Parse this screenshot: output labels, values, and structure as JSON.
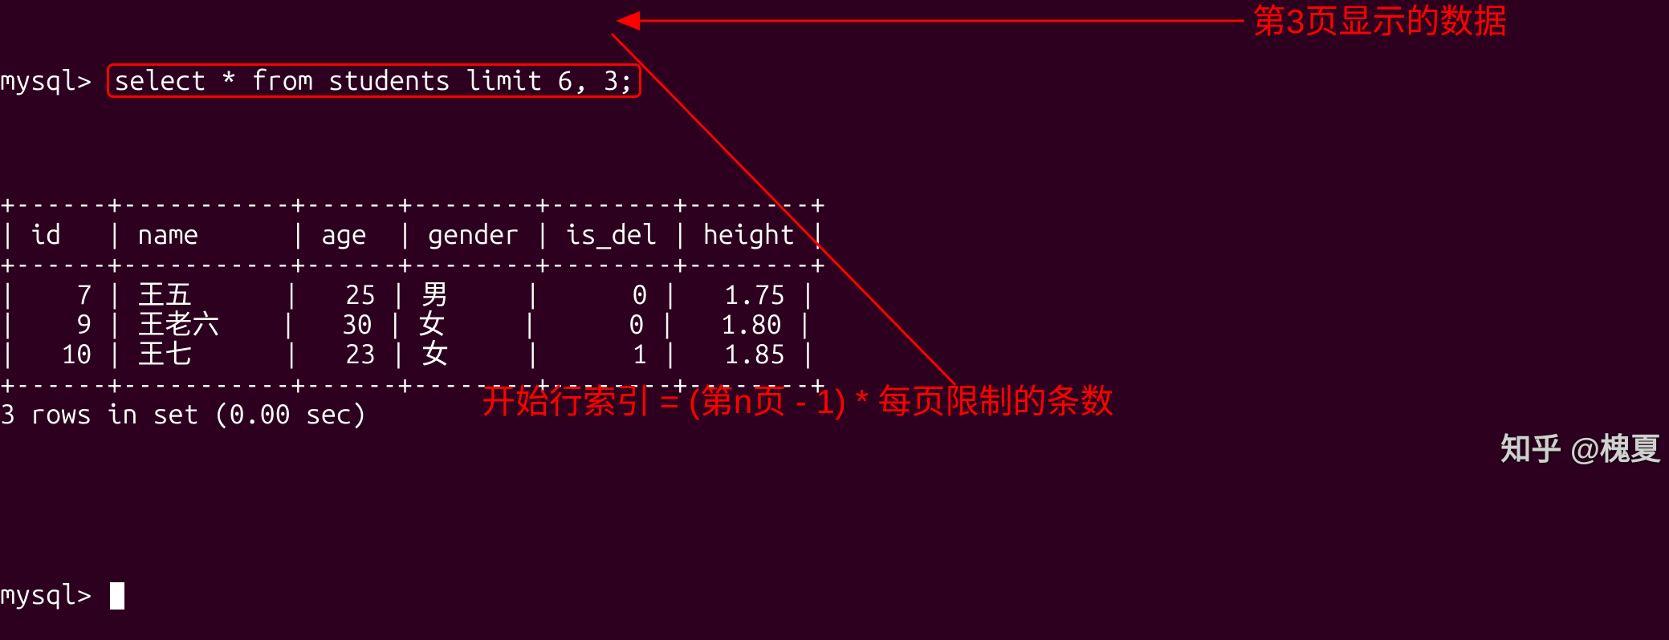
{
  "prompt": {
    "label": "mysql> ",
    "query": "select * from students limit 6, 3;"
  },
  "table": {
    "border_top": "+------+-----------+------+--------+--------+--------+",
    "header": "| id   | name      | age  | gender | is_del | height |",
    "border_mid": "+------+-----------+------+--------+--------+--------+",
    "columns": [
      "id",
      "name",
      "age",
      "gender",
      "is_del",
      "height"
    ],
    "rows_data": [
      {
        "id": 7,
        "name": "王五",
        "age": 25,
        "gender": "男",
        "is_del": 0,
        "height": 1.75
      },
      {
        "id": 9,
        "name": "王老六",
        "age": 30,
        "gender": "女",
        "is_del": 0,
        "height": 1.8
      },
      {
        "id": 10,
        "name": "王七",
        "age": 23,
        "gender": "女",
        "is_del": 1,
        "height": 1.85
      }
    ],
    "row1": "|    7 | 王五      |   25 | 男     |      0 |   1.75 |",
    "row2": "|    9 | 王老六    |   30 | 女     |      0 |   1.80 |",
    "row3": "|   10 | 王七      |   23 | 女     |      1 |   1.85 |",
    "border_bot": "+------+-----------+------+--------+--------+--------+"
  },
  "result": {
    "summary": "3 rows in set (0.00 sec)"
  },
  "prompt2": {
    "label": "mysql> "
  },
  "annotations": {
    "right": "第3页显示的数据",
    "bottom": "开始行索引 = (第n页 - 1) * 每页限制的条数"
  },
  "watermark": {
    "text": "知乎 @槐夏"
  }
}
